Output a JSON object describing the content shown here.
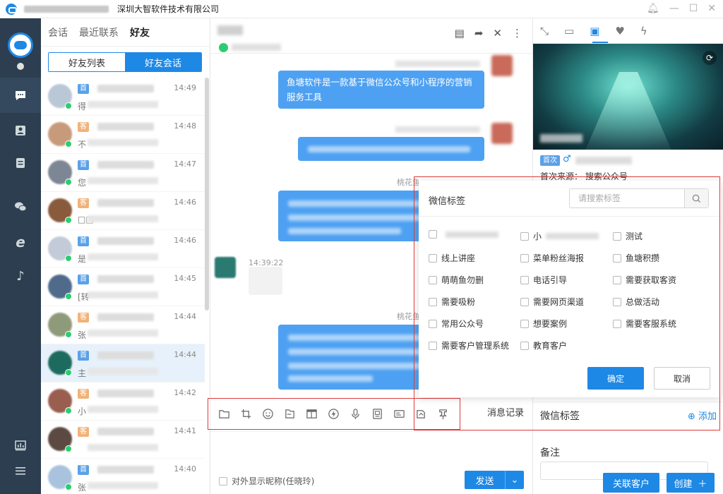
{
  "window": {
    "title": "深圳大智软件技术有限公司"
  },
  "nav": {
    "items": [
      "chat-icon",
      "contact-icon",
      "notes-icon",
      "wechat-icon",
      "ie-icon",
      "tiktok-icon",
      "stats-icon",
      "menu-icon"
    ]
  },
  "list": {
    "tabs": [
      "会话",
      "最近联系",
      "好友"
    ],
    "subtabs": [
      "好友列表",
      "好友会话"
    ],
    "rows": [
      {
        "tag": "首",
        "tag_color": "blue",
        "msg": "得",
        "time": "14:49",
        "avatar": "#b9c7d6"
      },
      {
        "tag": "客",
        "tag_color": "orange",
        "msg": "不",
        "time": "14:48",
        "avatar": "#c89a7c"
      },
      {
        "tag": "首",
        "tag_color": "blue",
        "msg": "您",
        "time": "14:47",
        "avatar": "#7d8694"
      },
      {
        "tag": "客",
        "tag_color": "orange",
        "msg": "□□",
        "time": "14:46",
        "avatar": "#8a5a3c"
      },
      {
        "tag": "首",
        "tag_color": "blue",
        "msg": "是",
        "time": "14:46",
        "avatar": "#c3cbd8"
      },
      {
        "tag": "首",
        "tag_color": "blue",
        "msg": "[转",
        "time": "14:45",
        "avatar": "#4f6a8a"
      },
      {
        "tag": "客",
        "tag_color": "orange",
        "msg": "张",
        "time": "14:44",
        "avatar": "#8f9a7a"
      },
      {
        "tag": "首",
        "tag_color": "blue",
        "msg": "主",
        "time": "14:44",
        "avatar": "#1d6a5e"
      },
      {
        "tag": "客",
        "tag_color": "orange",
        "msg": "小",
        "time": "14:42",
        "avatar": "#9a5e4e"
      },
      {
        "tag": "客",
        "tag_color": "orange",
        "msg": "",
        "time": "14:41",
        "avatar": "#5c4a42"
      },
      {
        "tag": "首",
        "tag_color": "blue",
        "msg": "张",
        "time": "14:40",
        "avatar": "#a9c3de"
      }
    ]
  },
  "chat": {
    "first_message": "鱼塘软件是一款基于微信公众号和小程序的营销服务工具",
    "sender_label_1": "桃花鱼",
    "sender_label_2": "桃花鱼",
    "time_left": "14:39:22",
    "toolbar_icons": [
      "folder-icon",
      "crop-icon",
      "emoji-icon",
      "file-icon",
      "layout-icon",
      "lightning-icon",
      "mic-icon",
      "card-icon",
      "id-card-icon",
      "transfer-icon",
      "pin-icon"
    ],
    "history_label": "消息记录",
    "nick_label": "对外显示昵称(任晓玲)",
    "send_label": "发送"
  },
  "profile": {
    "first_tag": "首次",
    "source_label": "首次来源：",
    "source_value": "搜索公众号",
    "tags_title": "微信标签",
    "add_label": "添加",
    "remark_label": "备注",
    "link_customer": "关联客户",
    "create": "创建"
  },
  "popup": {
    "title": "微信标签",
    "search_placeholder": "请搜索标签",
    "options": [
      [
        "",
        "小",
        "测试"
      ],
      [
        "线上讲座",
        "菜单粉丝海报",
        "鱼塘积攒"
      ],
      [
        "萌萌鱼勿删",
        "电话引导",
        "需要获取客资"
      ],
      [
        "需要吸粉",
        "需要网页渠道",
        "总做活动"
      ],
      [
        "常用公众号",
        "想要案例",
        "需要客服系统"
      ],
      [
        "需要客户管理系统",
        "教育客户",
        ""
      ]
    ],
    "ok": "确定",
    "cancel": "取消"
  }
}
